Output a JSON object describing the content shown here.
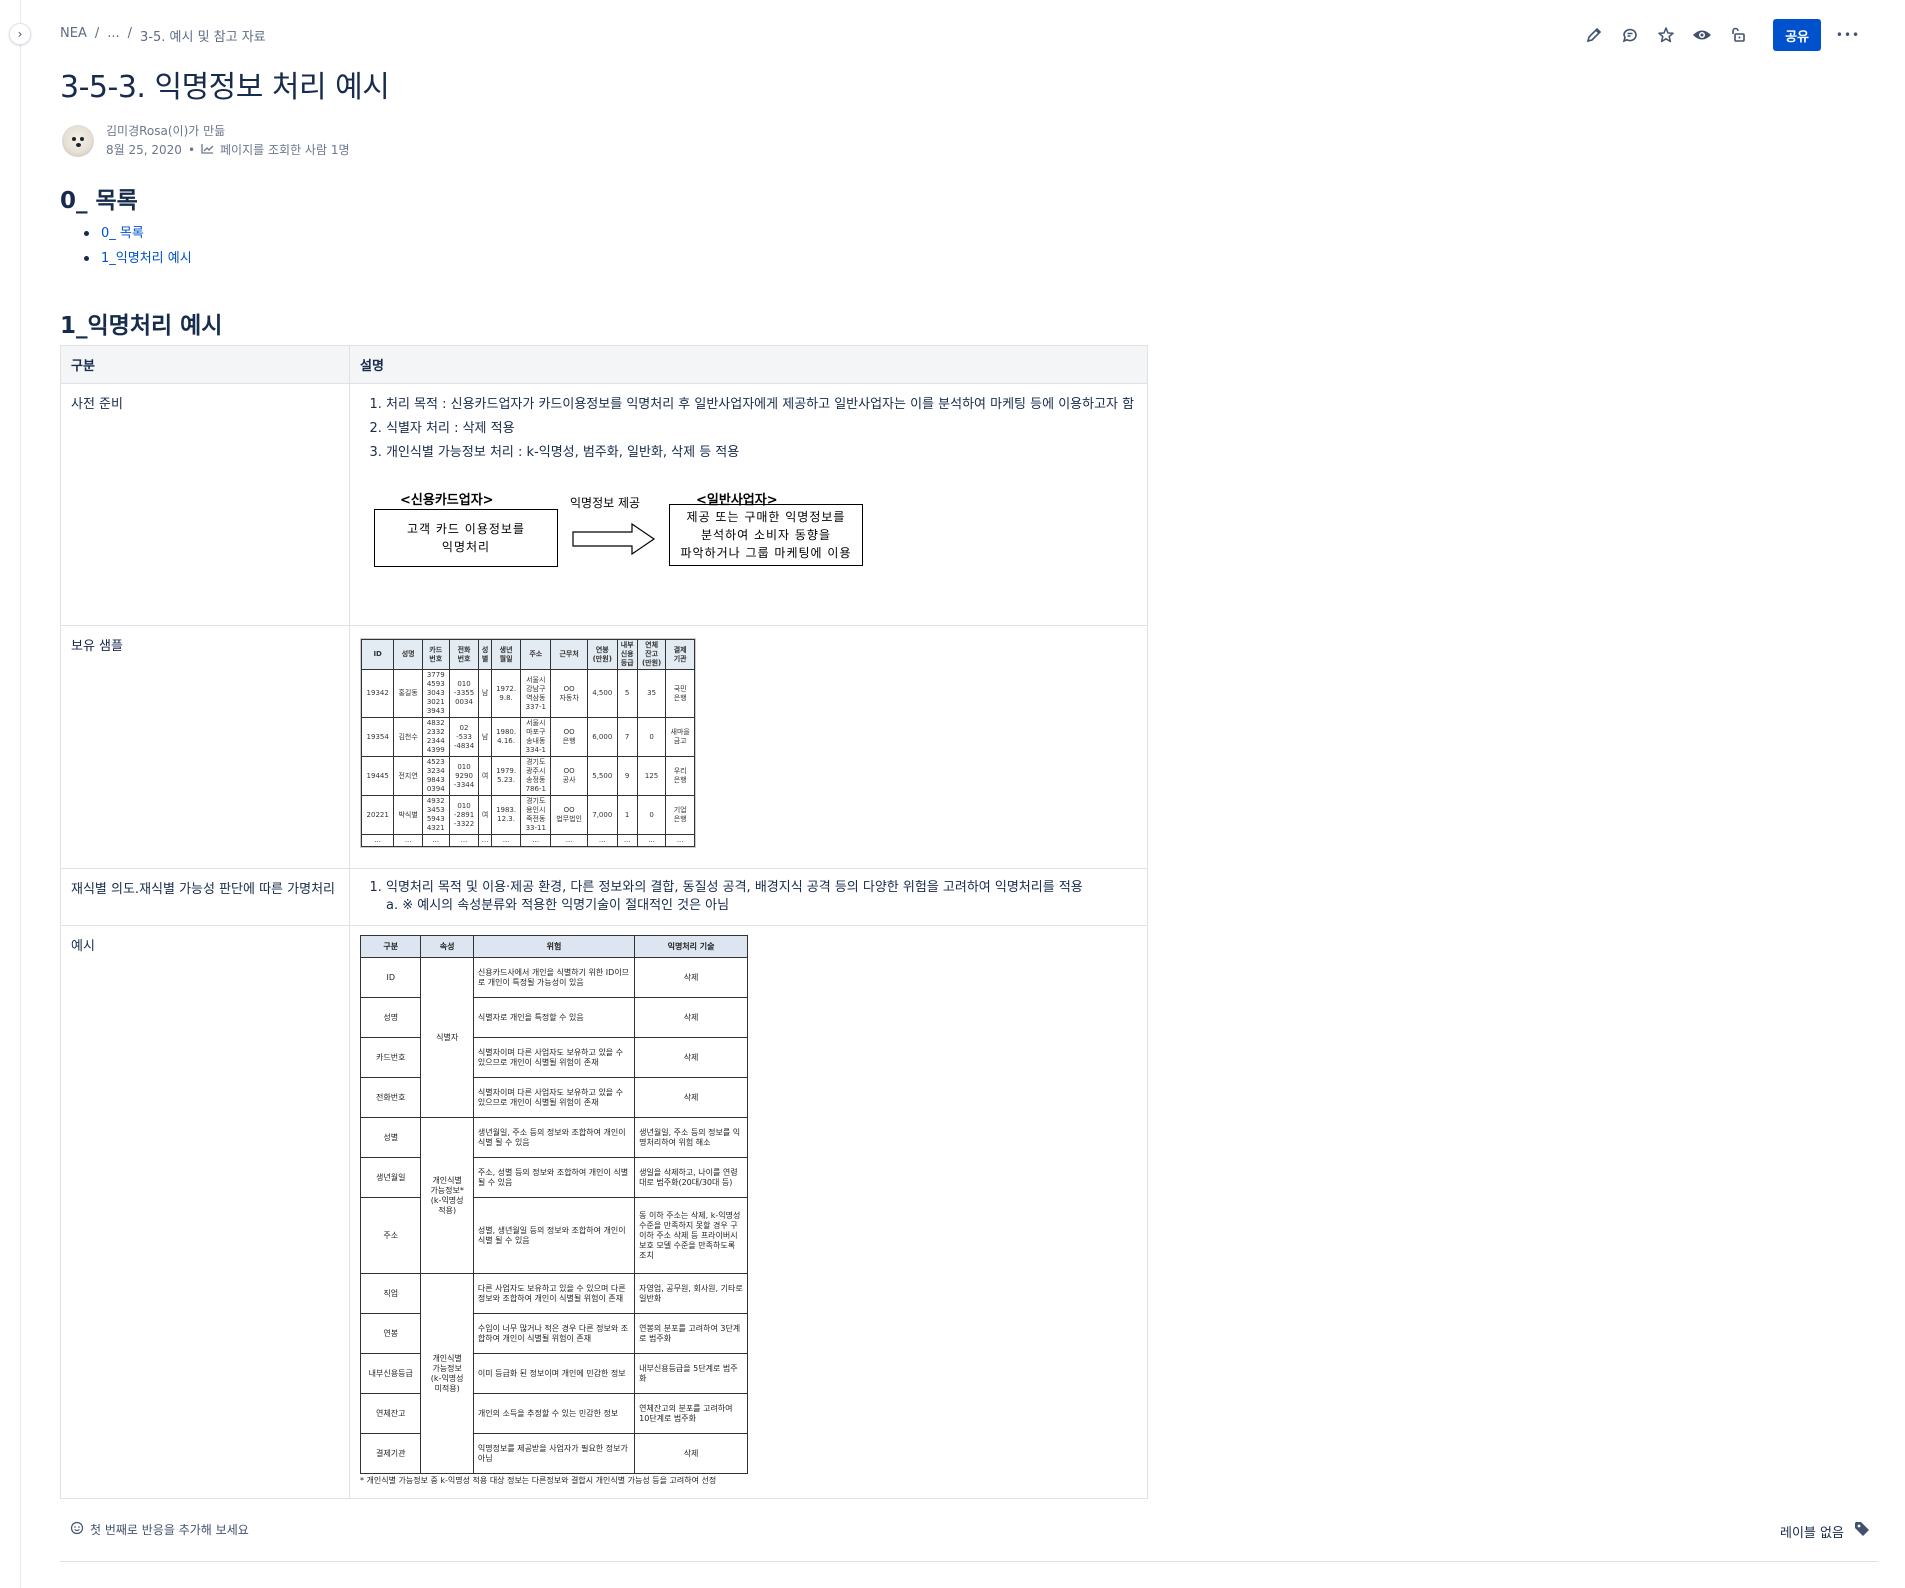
{
  "breadcrumb": {
    "root": "NEA",
    "sep": "/",
    "ellipsis": "...",
    "parent": "3-5. 예시 및 참고 자료"
  },
  "toolbar": {
    "share_label": "공유",
    "more_label": "•••"
  },
  "page": {
    "title": "3-5-3. 익명정보 처리 예시"
  },
  "byline": {
    "author": "김미경Rosa(이)가 만듦",
    "date": "8월 25, 2020",
    "views": "페이지를 조회한 사람 1명"
  },
  "toc": {
    "heading": "0_ 목록",
    "items": [
      "0_ 목록",
      "1_익명처리 예시"
    ]
  },
  "section1": {
    "heading": "1_익명처리 예시"
  },
  "table": {
    "headers": [
      "구분",
      "설명"
    ],
    "row1": {
      "label": "사전 준비",
      "items": [
        "처리 목적 : 신용카드업자가 카드이용정보를 익명처리 후 일반사업자에게 제공하고 일반사업자는 이를 분석하여 마케팅 등에 이용하고자 함",
        "식별자 처리 : 삭제 적용",
        "개인식별 가능정보 처리 : k-익명성, 범주화, 일반화, 삭제 등 적용"
      ],
      "diagram": {
        "left_title": "<신용카드업자>",
        "left_box": "고객 카드 이용정보를\n익명처리",
        "arrow_label": "익명정보 제공",
        "right_title": "<일반사업자>",
        "right_box": "제공 또는 구매한 익명정보를\n분석하여 소비자 동향을\n파악하거나 그룹 마케팅에 이용"
      }
    },
    "row2": {
      "label": "보유 샘플",
      "sample": {
        "headers": [
          "ID",
          "성명",
          "카드\n번호",
          "전화\n번호",
          "성\n별",
          "생년\n월일",
          "주소",
          "근무처",
          "연봉\n(만원)",
          "내부\n신용\n등급",
          "연체\n잔고\n(만원)",
          "결제\n기관"
        ],
        "rows": [
          [
            "19342",
            "홍길동",
            "3779\n4593\n3043\n3021\n3943",
            "010\n-3355\n0034",
            "남",
            "1972.\n9.8.",
            "서울시\n강남구\n역삼동\n337-1",
            "OO\n자동차",
            "4,500",
            "5",
            "35",
            "국민\n은행"
          ],
          [
            "19354",
            "김천수",
            "4832\n2332\n2344\n4399",
            "02\n-533\n-4834",
            "남",
            "1980.\n4.16.",
            "서울시\n마포구\n송내동\n334-1",
            "OO\n은행",
            "6,000",
            "7",
            "0",
            "새마을\n금고"
          ],
          [
            "19445",
            "전지연",
            "4523\n3234\n9843\n0394",
            "010\n9290\n-3344",
            "여",
            "1979.\n5.23.",
            "경기도\n광주시\n송정동\n786-1",
            "OO\n공사",
            "5,500",
            "9",
            "125",
            "우리\n은행"
          ],
          [
            "20221",
            "박식별",
            "4932\n3453\n5943\n4321",
            "010\n-2891\n-3322",
            "여",
            "1983.\n12.3.",
            "경기도\n용인시\n죽전동\n33-11",
            "OO\n법무법인",
            "7,000",
            "1",
            "0",
            "기업\n은행"
          ],
          [
            "...",
            "...",
            "...",
            "...",
            "...",
            "...",
            "...",
            "...",
            "...",
            "...",
            "...",
            "..."
          ]
        ]
      }
    },
    "row3": {
      "label": "재식별 의도.재식별 가능성 판단에 따른 가명처리",
      "item": "익명처리 목적 및 이용·제공 환경, 다른 정보와의 결합, 동질성 공격, 배경지식 공격 등의 다양한 위험을 고려하여 익명처리를 적용",
      "subitem": "a. ※ 예시의 속성분류와 적용한 익명기술이 절대적인 것은 아님"
    },
    "row4": {
      "label": "예시",
      "example": {
        "headers": [
          "구분",
          "속성",
          "위험",
          "익명처리 기술"
        ],
        "groups": [
          "식별자",
          "개인식별\n가능정보*\n(k-익명성\n적용)",
          "개인식별\n가능정보\n(k-익명성\n미적용)"
        ],
        "rows": [
          [
            "ID",
            "신용카드사에서 개인을 식별하기 위한 ID이므로 개인이 특정될 가능성이 있음",
            "삭제"
          ],
          [
            "성명",
            "식별자로 개인을 특정할 수 있음",
            "삭제"
          ],
          [
            "카드번호",
            "식별자이며 다른 사업자도 보유하고 있을 수 있으므로 개인이 식별될 위험이 존재",
            "삭제"
          ],
          [
            "전화번호",
            "식별자이며 다른 사업자도 보유하고 있을 수 있으므로 개인이 식별될 위험이 존재",
            "삭제"
          ],
          [
            "성별",
            "생년월일, 주소 등의 정보와 조합하여 개인이 식별 될 수 있음",
            "생년월일, 주소 등의 정보를 익명처리하여 위험 해소"
          ],
          [
            "생년월일",
            "주소, 성별 등의 정보와 조합하여 개인이 식별 될 수 있음",
            "생일을 삭제하고, 나이를 연령대로 범주화(20대/30대 등)"
          ],
          [
            "주소",
            "성별, 생년월일 등의 정보와 조합하여 개인이 식별 될 수 있음",
            "동 이하 주소는 삭제, k-익명성 수준을 만족하지 못할 경우 구 이하 주소 삭제 등 프라이버시 보호 모델 수준을 만족하도록 조치"
          ],
          [
            "직업",
            "다른 사업자도 보유하고 있을 수 있으며 다른 정보와 조합하여 개인이 식별될 위험이 존재",
            "자영업, 공무원, 회사원, 기타로 일반화"
          ],
          [
            "연봉",
            "수입이 너무 많거나 적은 경우 다른 정보와 조합하여 개인이 식별될 위험이 존재",
            "연봉의 분포를 고려하여 3단계로 범주화"
          ],
          [
            "내부신용등급",
            "이미 등급화 된 정보이며 개인에 민감한 정보",
            "내부신용등급을 5단계로 범주화"
          ],
          [
            "연체잔고",
            "개인의 소득을 추정할 수 있는 민감한 정보",
            "연체잔고의 분포를 고려하여 10단계로 범주화"
          ],
          [
            "결제기관",
            "익명정보를 제공받을 사업자가 필요한 정보가 아님",
            "삭제"
          ]
        ],
        "note": "* 개인식별 가능정보 중 k-익명성 적용 대상 정보는 다른정보와 결합시 개인식별 가능성 등을 고려하여 선정"
      }
    }
  },
  "footer": {
    "reaction": "첫 번째로 반응을 추가해 보세요",
    "labels": "레이블 없음"
  },
  "colors": {
    "primary": "#0052cc",
    "text": "#172b4d",
    "subtle": "#6b778c",
    "border": "#dfe1e6"
  }
}
